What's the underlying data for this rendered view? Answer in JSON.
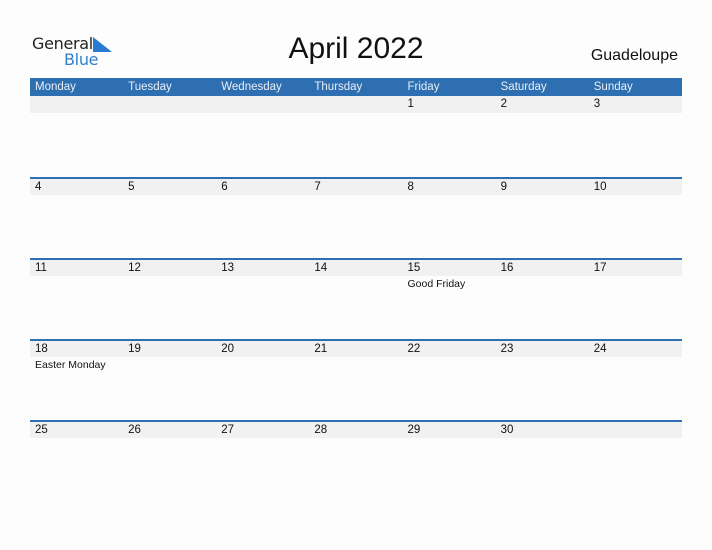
{
  "logo": {
    "line1": "General",
    "line2": "Blue"
  },
  "title": "April 2022",
  "region": "Guadeloupe",
  "colors": {
    "header_bg": "#2e6fb2",
    "day_row_bg": "#f1f1f1",
    "logo_blue": "#2f7fcf"
  },
  "weekdays": [
    "Monday",
    "Tuesday",
    "Wednesday",
    "Thursday",
    "Friday",
    "Saturday",
    "Sunday"
  ],
  "weeks": [
    {
      "days": [
        "",
        "",
        "",
        "",
        "1",
        "2",
        "3"
      ],
      "events": [
        "",
        "",
        "",
        "",
        "",
        "",
        ""
      ]
    },
    {
      "days": [
        "4",
        "5",
        "6",
        "7",
        "8",
        "9",
        "10"
      ],
      "events": [
        "",
        "",
        "",
        "",
        "",
        "",
        ""
      ]
    },
    {
      "days": [
        "11",
        "12",
        "13",
        "14",
        "15",
        "16",
        "17"
      ],
      "events": [
        "",
        "",
        "",
        "",
        "Good Friday",
        "",
        ""
      ]
    },
    {
      "days": [
        "18",
        "19",
        "20",
        "21",
        "22",
        "23",
        "24"
      ],
      "events": [
        "Easter Monday",
        "",
        "",
        "",
        "",
        "",
        ""
      ]
    },
    {
      "days": [
        "25",
        "26",
        "27",
        "28",
        "29",
        "30",
        ""
      ],
      "events": [
        "",
        "",
        "",
        "",
        "",
        "",
        ""
      ]
    }
  ]
}
